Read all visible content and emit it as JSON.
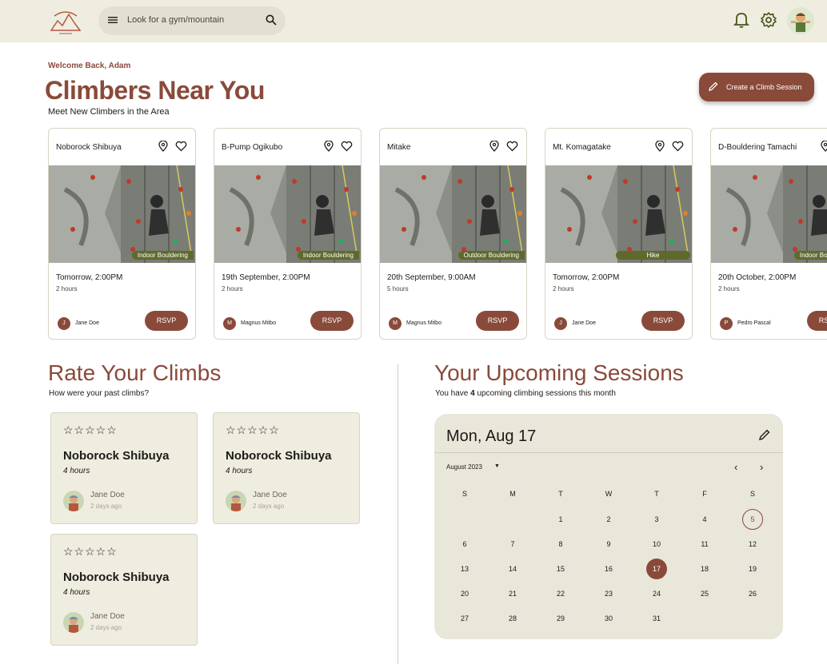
{
  "header": {
    "search_placeholder": "Look for a gym/mountain"
  },
  "welcome": "Welcome Back, Adam",
  "title": "Climbers Near You",
  "subtitle": "Meet New Climbers in the Area",
  "create_button": "Create a Climb Session",
  "sessions": [
    {
      "name": "Noborock Shibuya",
      "tag": "Indoor Bouldering",
      "when": "Tomorrow, 2:00PM",
      "duration": "2 hours",
      "host_initial": "J",
      "host": "Jane Doe",
      "rsvp": "RSVP"
    },
    {
      "name": "B-Pump Ogikubo",
      "tag": "Indoor Bouldering",
      "when": "19th September, 2:00PM",
      "duration": "2 hours",
      "host_initial": "M",
      "host": "Magnus Mitbo",
      "rsvp": "RSVP"
    },
    {
      "name": "Mitake",
      "tag": "Outdoor Bouldering",
      "when": "20th September, 9:00AM",
      "duration": "5 hours",
      "host_initial": "M",
      "host": "Magnus Mitbo",
      "rsvp": "RSVP"
    },
    {
      "name": "Mt. Komagatake",
      "tag": "Hike",
      "when": "Tomorrow, 2:00PM",
      "duration": "2 hours",
      "host_initial": "J",
      "host": "Jane Doe",
      "rsvp": "RSVP"
    },
    {
      "name": "D-Bouldering Tamachi",
      "tag": "Indoor Bouldering",
      "when": "20th October, 2:00PM",
      "duration": "2 hours",
      "host_initial": "P",
      "host": "Pedro Pascal",
      "rsvp": "RSVP"
    }
  ],
  "rate": {
    "title": "Rate Your Climbs",
    "subtitle": "How were your past climbs?",
    "items": [
      {
        "stars": "☆☆☆☆☆",
        "gym": "Noborock Shibuya",
        "hours": "4 hours",
        "user": "Jane Doe",
        "ago": "2 days ago"
      },
      {
        "stars": "☆☆☆☆☆",
        "gym": "Noborock Shibuya",
        "hours": "4 hours",
        "user": "Jane Doe",
        "ago": "2 days ago"
      },
      {
        "stars": "☆☆☆☆☆",
        "gym": "Noborock Shibuya",
        "hours": "4 hours",
        "user": "Jane Doe",
        "ago": "2 days ago"
      }
    ]
  },
  "upcoming": {
    "title": "Your Upcoming Sessions",
    "sub_prefix": "You have ",
    "count": "4",
    "sub_suffix": " upcoming climbing sessions this month"
  },
  "calendar": {
    "selected_label": "Mon, Aug 17",
    "month_label": "August 2023",
    "weekdays": [
      "S",
      "M",
      "T",
      "W",
      "T",
      "F",
      "S"
    ],
    "weeks": [
      [
        "",
        "",
        "1",
        "2",
        "3",
        "4",
        "5"
      ],
      [
        "6",
        "7",
        "8",
        "9",
        "10",
        "11",
        "12"
      ],
      [
        "13",
        "14",
        "15",
        "16",
        "17",
        "18",
        "19"
      ],
      [
        "20",
        "21",
        "22",
        "23",
        "24",
        "25",
        "26"
      ],
      [
        "27",
        "28",
        "29",
        "30",
        "31",
        "",
        ""
      ]
    ],
    "today": "5",
    "selected": "17"
  },
  "colors": {
    "brand": "#8a4a3a",
    "tag": "#5e6a2c",
    "header_bg": "#efede0"
  }
}
